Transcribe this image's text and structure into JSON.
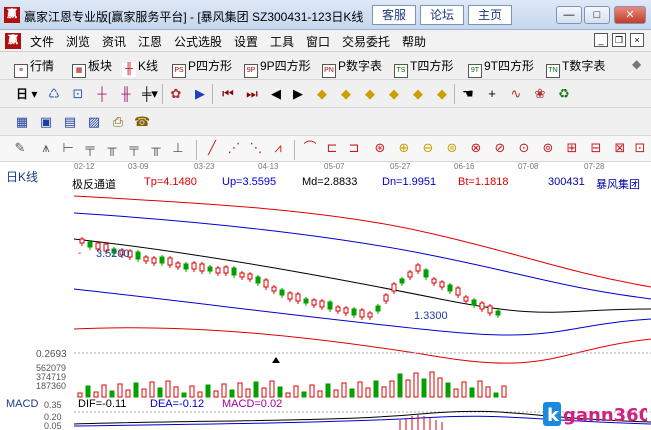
{
  "window": {
    "logo_text": "赢",
    "title": "赢家江恩专业版[赢家服务平台] - [暴风集团  SZ300431-123日K线",
    "header_links": [
      "客服",
      "论坛",
      "主页"
    ],
    "controls": [
      "—",
      "□",
      "✕"
    ]
  },
  "menu": {
    "logo_text": "赢",
    "items": [
      "文件",
      "浏览",
      "资讯",
      "江恩",
      "公式选股",
      "设置",
      "工具",
      "窗口",
      "交易委托",
      "帮助"
    ],
    "mdi_controls": [
      "_",
      "❐",
      "×"
    ]
  },
  "toolbar_main": {
    "items": [
      {
        "label": "行情",
        "icon": "quote-icon"
      },
      {
        "label": "板块",
        "icon": "sector-icon"
      },
      {
        "label": "K线",
        "icon": "kline-icon"
      },
      {
        "label": "P四方形",
        "icon": "PS"
      },
      {
        "label": "9P四方形",
        "icon": "9P"
      },
      {
        "label": "P数字表",
        "icon": "PN"
      },
      {
        "label": "T四方形",
        "icon": "TS"
      },
      {
        "label": "9T四方形",
        "icon": "9T"
      },
      {
        "label": "T数字表",
        "icon": "TN"
      }
    ],
    "more": "◆"
  },
  "toolbar_period": {
    "period_label": "日"
  },
  "chart": {
    "side_label": "日K线",
    "indicator_name": "极反通道",
    "Tp": "Tp=4.1480",
    "Up": "Up=3.5595",
    "Md": "Md=2.8833",
    "Dn": "Dn=1.9951",
    "Bt": "Bt=1.1818",
    "stock_code": "300431",
    "stock_name": "暴风集团",
    "date_ticks": [
      "02-12",
      "03-09",
      "03-23",
      "04-13",
      "05-07",
      "05-27",
      "06-16",
      "07-08",
      "07-28"
    ],
    "annotations": {
      "high": "3.5200",
      "low": "1.3300"
    },
    "price_scale_label": "0.2693",
    "volume_scale": [
      "562079",
      "374719",
      "187360"
    ],
    "macd_panel": {
      "name": "MACD",
      "dif": "DIF=-0.11",
      "dea": "DEA=-0.12",
      "macd": "MACD=0.02",
      "scale": [
        "0.35",
        "0.20",
        "0.05"
      ]
    },
    "colors": {
      "up": "#e00000",
      "down": "#00a000",
      "upper_band": "#e00000",
      "mid_band": "#0000d0",
      "lower_band": "#000000"
    }
  },
  "watermark": {
    "text": "gann360",
    "prefix": "k"
  }
}
